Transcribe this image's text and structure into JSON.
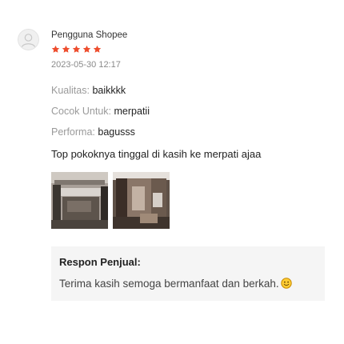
{
  "review": {
    "username": "Pengguna Shopee",
    "rating": 5,
    "rating_max": 5,
    "timestamp": "2023-05-30 12:17",
    "star_color": "#ee4d2d",
    "attributes": [
      {
        "label": "Kualitas:",
        "value": "baikkkk"
      },
      {
        "label": "Cocok Untuk:",
        "value": "merpatii"
      },
      {
        "label": "Performa:",
        "value": "bagusss"
      }
    ],
    "comment": "Top pokoknya tinggal di kasih ke merpati ajaa",
    "media_count": 2,
    "avatar_icon": "user-avatar-icon",
    "emoji_icon": "smiley-emoji-icon"
  },
  "seller_reply": {
    "title": "Respon Penjual:",
    "text": "Terima kasih semoga bermanfaat dan berkah."
  }
}
